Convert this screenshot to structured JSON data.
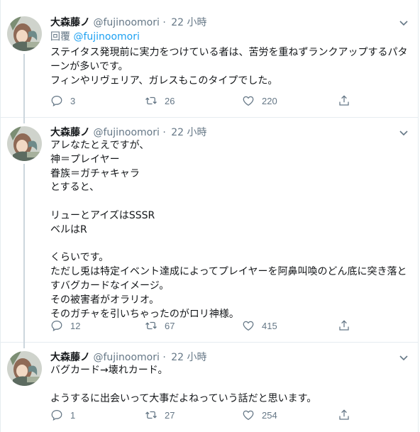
{
  "tweets": [
    {
      "name": "大森藤ノ",
      "handle": "@fujinoomori",
      "dot": "·",
      "time": "22 小時",
      "reply_label": "回覆",
      "reply_mention": "@fujinoomori",
      "text": "ステイタス発現前に実力をつけている者は、苦労を重ねずランクアップするパターンが多いです。\nフィンやリヴェリア、ガレスもこのタイプでした。",
      "replies": "3",
      "retweets": "26",
      "likes": "220"
    },
    {
      "name": "大森藤ノ",
      "handle": "@fujinoomori",
      "dot": "·",
      "time": "22 小時",
      "text": "アレなたとえですが、\n神＝プレイヤー\n眷族＝ガチャキャラ\nとすると、\n\nリューとアイズはSSSR\nベルはR\n\nくらいです。\nただし兎は特定イベント達成によってプレイヤーを阿鼻叫喚のどん底に突き落とすバグカードなイメージ。\nその被害者がオラリオ。\nそのガチャを引いちゃったのがロリ神様。",
      "replies": "12",
      "retweets": "67",
      "likes": "415"
    },
    {
      "name": "大森藤ノ",
      "handle": "@fujinoomori",
      "dot": "·",
      "time": "22 小時",
      "text": "バグカード→壊れカード。\n\nようするに出会いって大事だよねっていう話だと思います。",
      "replies": "1",
      "retweets": "27",
      "likes": "254"
    }
  ],
  "icons": {
    "reply": "reply-icon",
    "retweet": "retweet-icon",
    "like": "heart-icon",
    "share": "share-icon",
    "caret": "chevron-down-icon"
  },
  "colors": {
    "text": "#14171a",
    "secondary": "#657786",
    "link": "#1da1f2",
    "border": "#e6ecf0",
    "thread_line": "#ccd6dd"
  }
}
